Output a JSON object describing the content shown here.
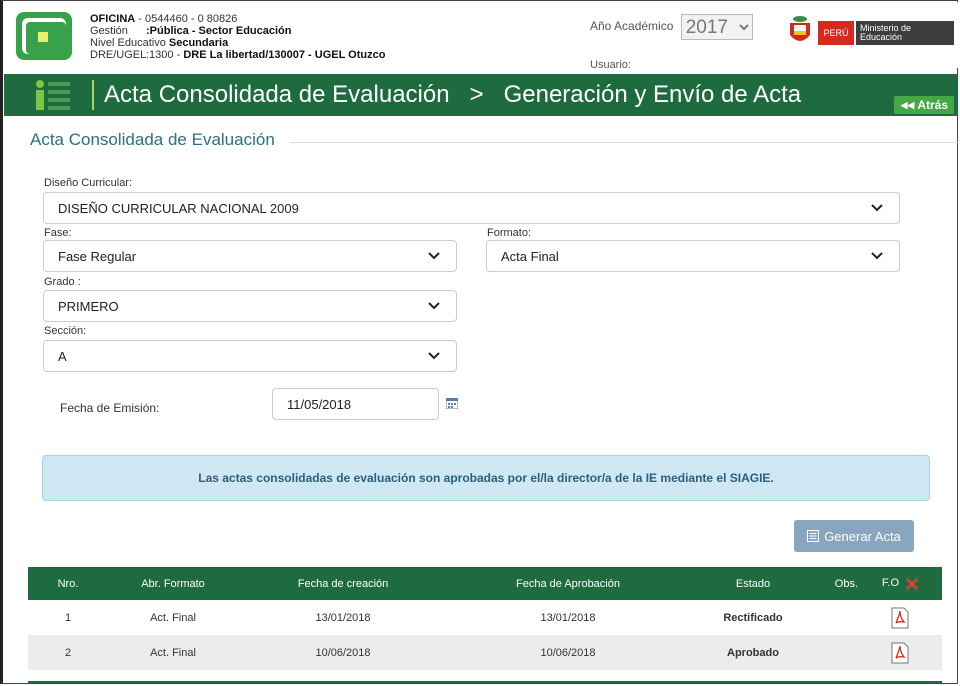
{
  "header": {
    "oficina_label": "OFICINA",
    "oficina_value": " - 0544460 - 0  80826",
    "gestion_label": "Gestión",
    "gestion_value": ":Pública - Sector Educación",
    "nivel_label": "Nivel Educativo",
    "nivel_value": "Secundaria",
    "dre_label": "DRE/UGEL",
    "dre_value_prefix": ":1300 - ",
    "dre_value_bold": "DRE La libertad/130007 - UGEL Otuzco",
    "ano_label": "Año Académico",
    "ano_value": "2017",
    "usuario_label": "Usuario:",
    "peru_label": "PERÚ",
    "ministerio_label": "Ministerio de Educación"
  },
  "titlebar": {
    "title": "Acta Consolidada de Evaluación   >   Generación y Envío de Acta",
    "back_label": "Atrás"
  },
  "form": {
    "section_title": "Acta Consolidada de Evaluación",
    "diseno_label": "Diseño Curricular:",
    "diseno_value": "DISEÑO CURRICULAR NACIONAL 2009",
    "fase_label": "Fase:",
    "fase_value": "Fase Regular",
    "formato_label": "Formato:",
    "formato_value": "Acta Final",
    "grado_label": "Grado :",
    "grado_value": "PRIMERO",
    "seccion_label": "Sección:",
    "seccion_value": "A",
    "fecha_label": "Fecha de Emisión:",
    "fecha_value": "11/05/2018"
  },
  "alert": {
    "text": "Las actas consolidadas de evaluación son aprobadas por el/la director/a de la IE mediante el SIAGIE."
  },
  "actions": {
    "generar_label": "Generar Acta"
  },
  "table": {
    "columns": [
      "Nro.",
      "Abr. Formato",
      "Fecha de creación",
      "Fecha de Aprobación",
      "Estado",
      "Obs.",
      "F.O"
    ],
    "rows": [
      {
        "nro": "1",
        "formato": "Act. Final",
        "creacion": "13/01/2018",
        "aprobacion": "13/01/2018",
        "estado": "Rectificado"
      },
      {
        "nro": "2",
        "formato": "Act. Final",
        "creacion": "10/06/2018",
        "aprobacion": "10/06/2018",
        "estado": "Aprobado"
      }
    ]
  },
  "colors": {
    "primary_green": "#1e6b3f",
    "accent_green": "#45a845",
    "alert_bg": "#cfe8f4",
    "peru_red": "#d52b1e"
  }
}
